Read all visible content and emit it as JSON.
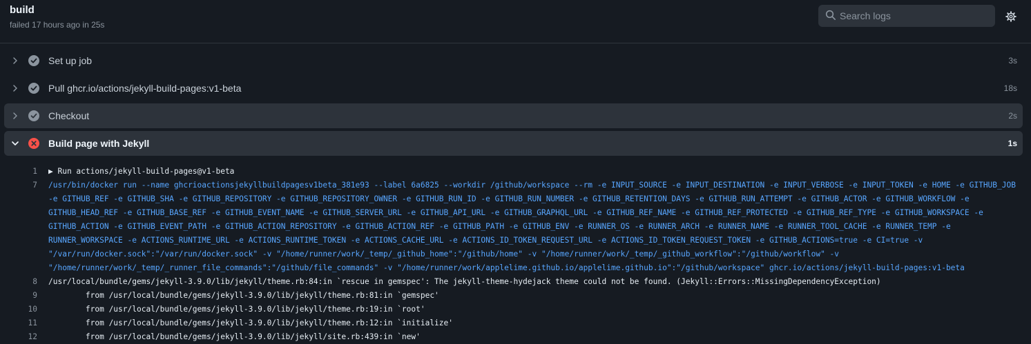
{
  "header": {
    "title": "build",
    "meta": "failed 17 hours ago in 25s",
    "search_placeholder": "Search logs"
  },
  "steps": [
    {
      "name": "Set up job",
      "duration": "3s",
      "status": "success"
    },
    {
      "name": "Pull ghcr.io/actions/jekyll-build-pages:v1-beta",
      "duration": "18s",
      "status": "success"
    },
    {
      "name": "Checkout",
      "duration": "2s",
      "status": "success"
    },
    {
      "name": "Build page with Jekyll",
      "duration": "1s",
      "status": "failure"
    }
  ],
  "log": [
    {
      "num": "1",
      "text": "▶ Run actions/jekyll-build-pages@v1-beta"
    },
    {
      "num": "7",
      "text": "/usr/bin/docker run --name ghcrioactionsjekyllbuildpagesv1beta_381e93 --label 6a6825 --workdir /github/workspace --rm -e INPUT_SOURCE -e INPUT_DESTINATION -e INPUT_VERBOSE -e INPUT_TOKEN -e HOME -e GITHUB_JOB -e GITHUB_REF -e GITHUB_SHA -e GITHUB_REPOSITORY -e GITHUB_REPOSITORY_OWNER -e GITHUB_RUN_ID -e GITHUB_RUN_NUMBER -e GITHUB_RETENTION_DAYS -e GITHUB_RUN_ATTEMPT -e GITHUB_ACTOR -e GITHUB_WORKFLOW -e GITHUB_HEAD_REF -e GITHUB_BASE_REF -e GITHUB_EVENT_NAME -e GITHUB_SERVER_URL -e GITHUB_API_URL -e GITHUB_GRAPHQL_URL -e GITHUB_REF_NAME -e GITHUB_REF_PROTECTED -e GITHUB_REF_TYPE -e GITHUB_WORKSPACE -e GITHUB_ACTION -e GITHUB_EVENT_PATH -e GITHUB_ACTION_REPOSITORY -e GITHUB_ACTION_REF -e GITHUB_PATH -e GITHUB_ENV -e RUNNER_OS -e RUNNER_ARCH -e RUNNER_NAME -e RUNNER_TOOL_CACHE -e RUNNER_TEMP -e RUNNER_WORKSPACE -e ACTIONS_RUNTIME_URL -e ACTIONS_RUNTIME_TOKEN -e ACTIONS_CACHE_URL -e ACTIONS_ID_TOKEN_REQUEST_URL -e ACTIONS_ID_TOKEN_REQUEST_TOKEN -e GITHUB_ACTIONS=true -e CI=true -v \"/var/run/docker.sock\":\"/var/run/docker.sock\" -v \"/home/runner/work/_temp/_github_home\":\"/github/home\" -v \"/home/runner/work/_temp/_github_workflow\":\"/github/workflow\" -v \"/home/runner/work/_temp/_runner_file_commands\":\"/github/file_commands\" -v \"/home/runner/work/applelime.github.io/applelime.github.io\":\"/github/workspace\" ghcr.io/actions/jekyll-build-pages:v1-beta",
      "style": "cmd"
    },
    {
      "num": "8",
      "text": "/usr/local/bundle/gems/jekyll-3.9.0/lib/jekyll/theme.rb:84:in `rescue in gemspec': The jekyll-theme-hydejack theme could not be found. (Jekyll::Errors::MissingDependencyException)"
    },
    {
      "num": "9",
      "text": "        from /usr/local/bundle/gems/jekyll-3.9.0/lib/jekyll/theme.rb:81:in `gemspec'"
    },
    {
      "num": "10",
      "text": "        from /usr/local/bundle/gems/jekyll-3.9.0/lib/jekyll/theme.rb:19:in `root'"
    },
    {
      "num": "11",
      "text": "        from /usr/local/bundle/gems/jekyll-3.9.0/lib/jekyll/theme.rb:12:in `initialize'"
    },
    {
      "num": "12",
      "text": "        from /usr/local/bundle/gems/jekyll-3.9.0/lib/jekyll/site.rb:439:in `new'"
    }
  ],
  "colors": {
    "background": "#161b22",
    "highlight": "#2d333b",
    "success": "#8b949e",
    "failure": "#f85149",
    "command": "#58a6ff"
  }
}
